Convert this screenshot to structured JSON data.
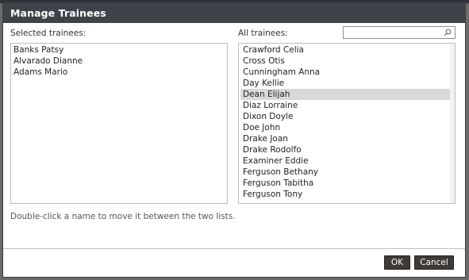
{
  "dialog": {
    "title": "Manage Trainees",
    "selected_label": "Selected trainees:",
    "all_label": "All trainees:",
    "search_placeholder": "",
    "hint": "Double-click a name to move it between the two lists.",
    "ok_label": "OK",
    "cancel_label": "Cancel"
  },
  "selected_trainees": [
    "Banks Patsy",
    "Alvarado Dianne",
    "Adams Mario"
  ],
  "all_trainees": [
    "Crawford Celia",
    "Cross Otis",
    "Cunningham Anna",
    "Day Kellie",
    "Dean Elijah",
    "Diaz Lorraine",
    "Dixon Doyle",
    "Doe John",
    "Drake Joan",
    "Drake Rodolfo",
    "Examiner Eddie",
    "Ferguson Bethany",
    "Ferguson Tabitha",
    "Ferguson Tony"
  ],
  "selected_index": 4
}
